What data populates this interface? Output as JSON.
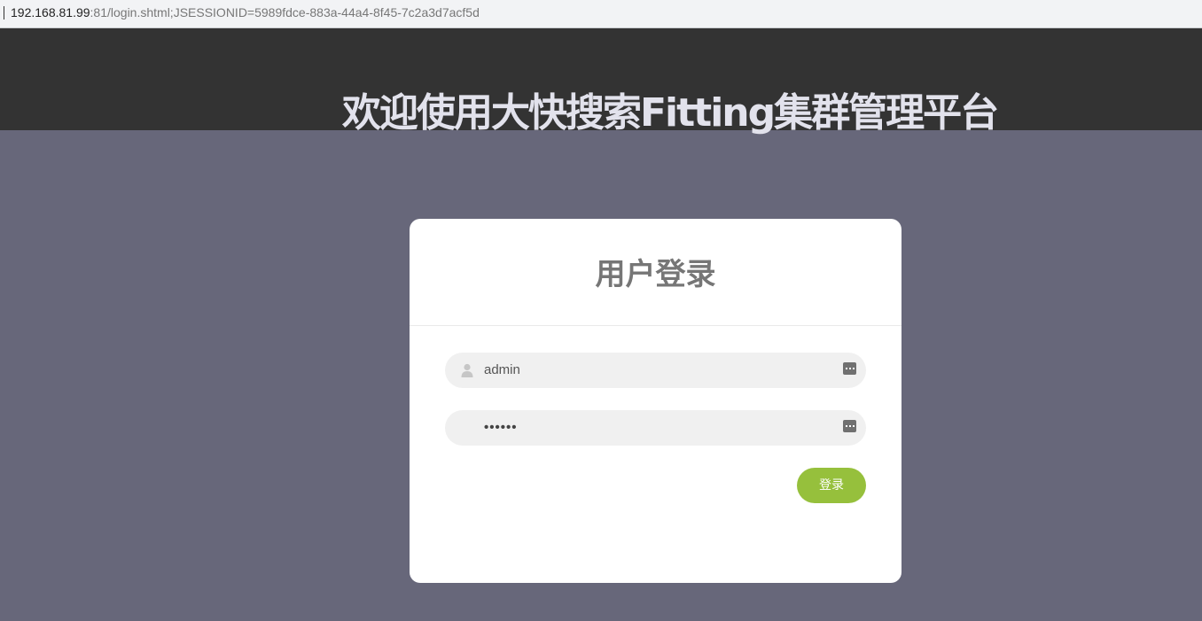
{
  "browser": {
    "address_host": "192.168.81.99",
    "address_rest": ":81/login.shtml;JSESSIONID=5989fdce-883a-44a4-8f45-7c2a3d7acf5d"
  },
  "header": {
    "title": "欢迎使用大快搜索Fitting集群管理平台"
  },
  "login": {
    "title": "用户登录",
    "username_value": "admin",
    "password_mask": "••••••",
    "submit_label": "登录"
  },
  "icons": {
    "user": "user-icon",
    "autofill": "autofill-key-icon"
  },
  "colors": {
    "page_bg": "#67677a",
    "header_bg": "#333333",
    "header_text": "#e2e2ec",
    "card_bg": "#ffffff",
    "button_bg": "#96c03c"
  }
}
